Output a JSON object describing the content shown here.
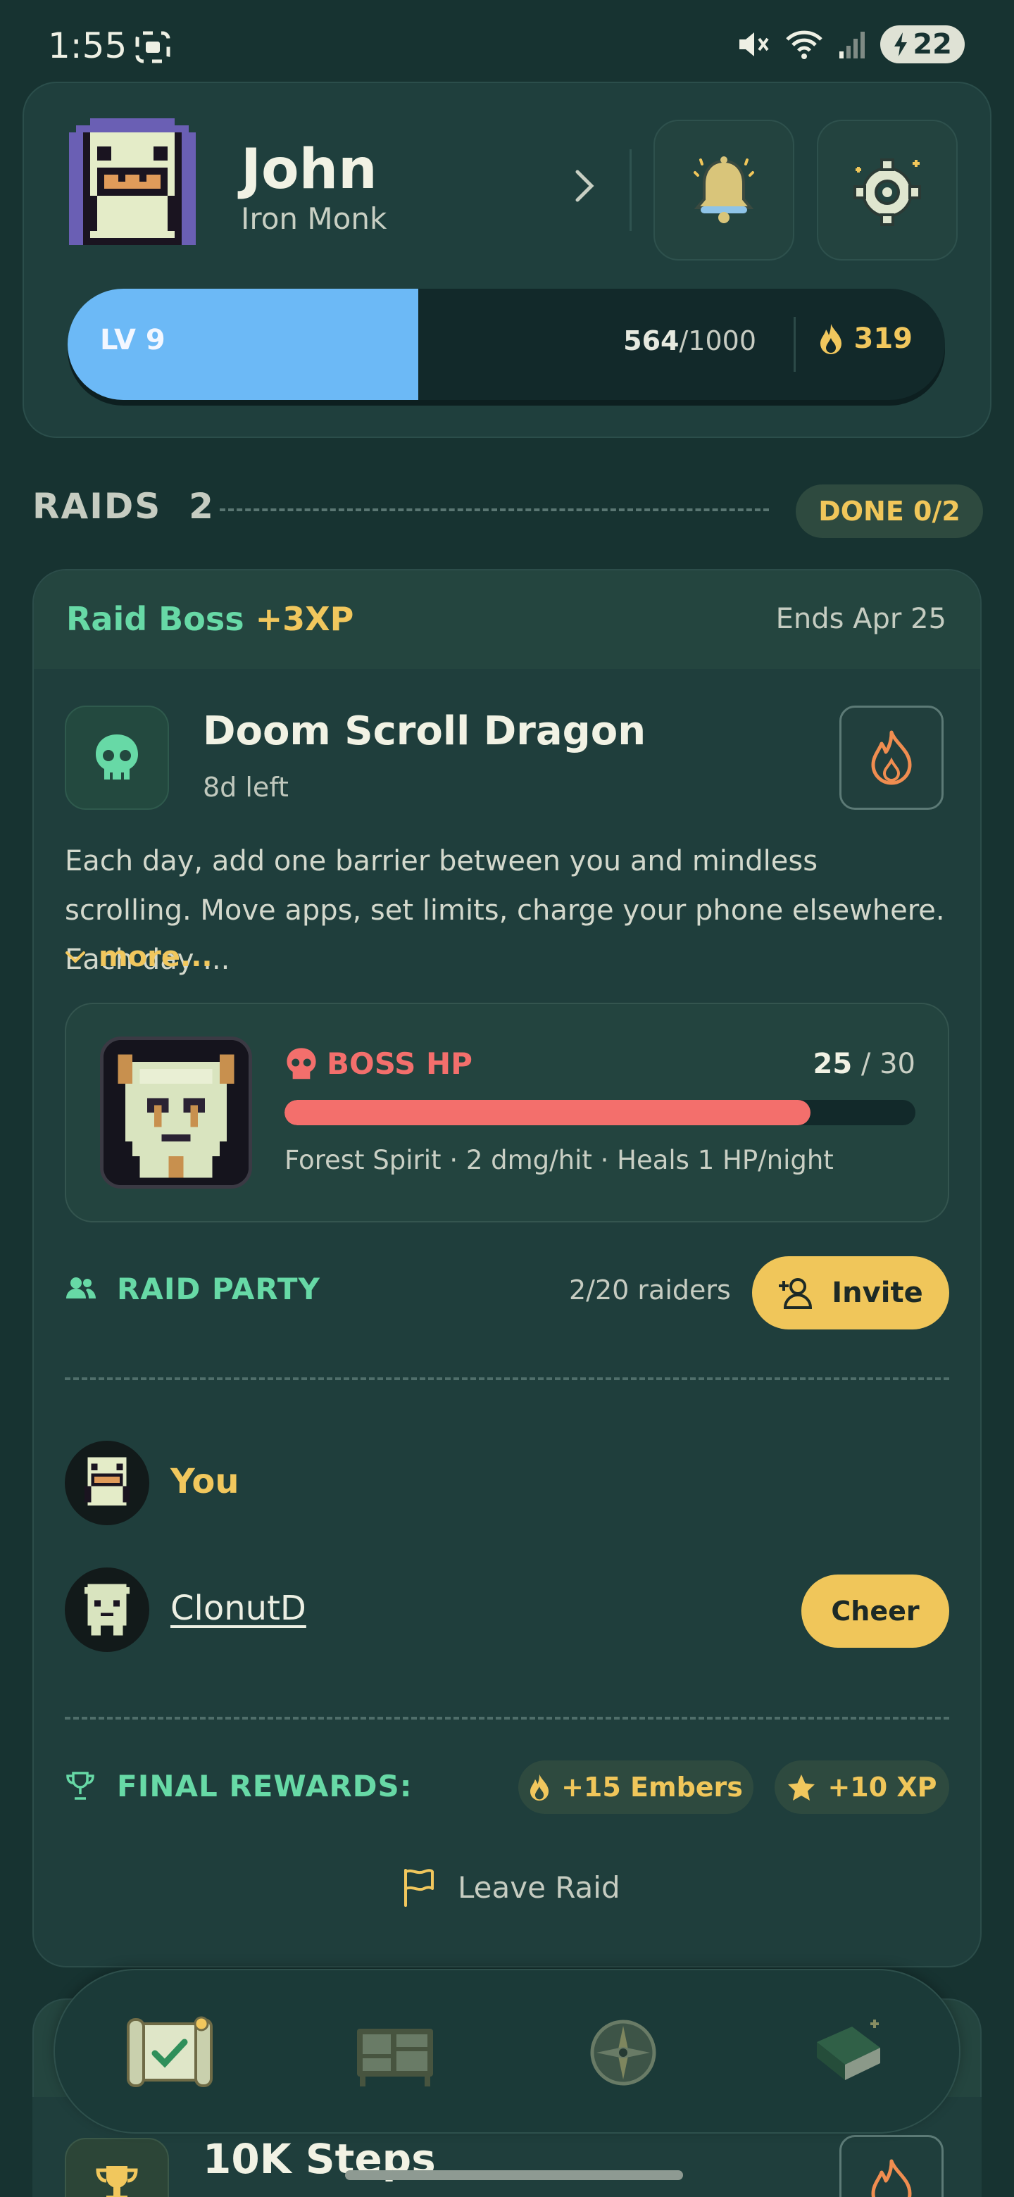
{
  "status_bar": {
    "time": "1:55",
    "battery": "22"
  },
  "profile": {
    "name": "John",
    "title": "Iron Monk",
    "level_label": "LV 9",
    "xp_current": "564",
    "xp_max": "/1000",
    "xp_fraction": 0.564,
    "embers": "319"
  },
  "raids_section": {
    "title": "RAIDS",
    "count": "2",
    "done_badge": "DONE 0/2"
  },
  "raid": {
    "label": "Raid Boss",
    "xp_bonus": "+3XP",
    "ends": "Ends Apr 25",
    "boss_name": "Doom Scroll Dragon",
    "time_left": "8d left",
    "description": "Each day, add one barrier between you and mindless scrolling. Move apps, set limits, charge your phone elsewhere. Each day ...",
    "more_label": "more...",
    "hp_label": "BOSS HP",
    "hp_current": "25",
    "hp_max": "/ 30",
    "hp_fraction": 0.8333,
    "boss_stats": "Forest Spirit · 2 dmg/hit · Heals 1 HP/night",
    "party_label": "RAID PARTY",
    "raiders": "2/20 raiders",
    "invite_label": "Invite",
    "members": [
      {
        "name": "You"
      },
      {
        "name": "ClonutD",
        "action": "Cheer"
      }
    ],
    "final_rewards_label": "FINAL REWARDS:",
    "reward_embers": "+15 Embers",
    "reward_xp": "+10 XP",
    "leave_label": "Leave Raid"
  },
  "next_card": {
    "title": "10K Steps"
  },
  "colors": {
    "background": "#173331",
    "accent_green": "#67d9a6",
    "accent_gold": "#f0c65a",
    "xp_blue": "#6cb9f6",
    "hp_red": "#f36f6c"
  },
  "nav": [
    "quests-scroll-icon",
    "quest-board-icon",
    "compass-icon",
    "journal-book-icon"
  ]
}
